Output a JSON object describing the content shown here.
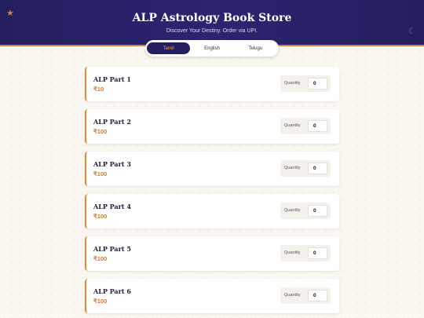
{
  "header": {
    "title": "ALP Astrology Book Store",
    "subtitle": "Discover Your Destiny. Order via UPI."
  },
  "tabs": [
    {
      "label": "Tamil",
      "active": true
    },
    {
      "label": "English",
      "active": false
    },
    {
      "label": "Telugu",
      "active": false
    }
  ],
  "quantity_label": "Quantity",
  "books": [
    {
      "name": "ALP Part 1",
      "price": "₹10",
      "quantity": "0"
    },
    {
      "name": "ALP Part 2",
      "price": "₹100",
      "quantity": "0"
    },
    {
      "name": "ALP Part 3",
      "price": "₹100",
      "quantity": "0"
    },
    {
      "name": "ALP Part 4",
      "price": "₹100",
      "quantity": "0"
    },
    {
      "name": "ALP Part 5",
      "price": "₹100",
      "quantity": "0"
    },
    {
      "name": "ALP Part 6",
      "price": "₹100",
      "quantity": "0"
    }
  ],
  "colors": {
    "header_bg": "#241d5e",
    "accent": "#e08a2c",
    "active_tab_text": "#f2a540"
  },
  "icons": [
    "star-icon",
    "moon-icon"
  ]
}
